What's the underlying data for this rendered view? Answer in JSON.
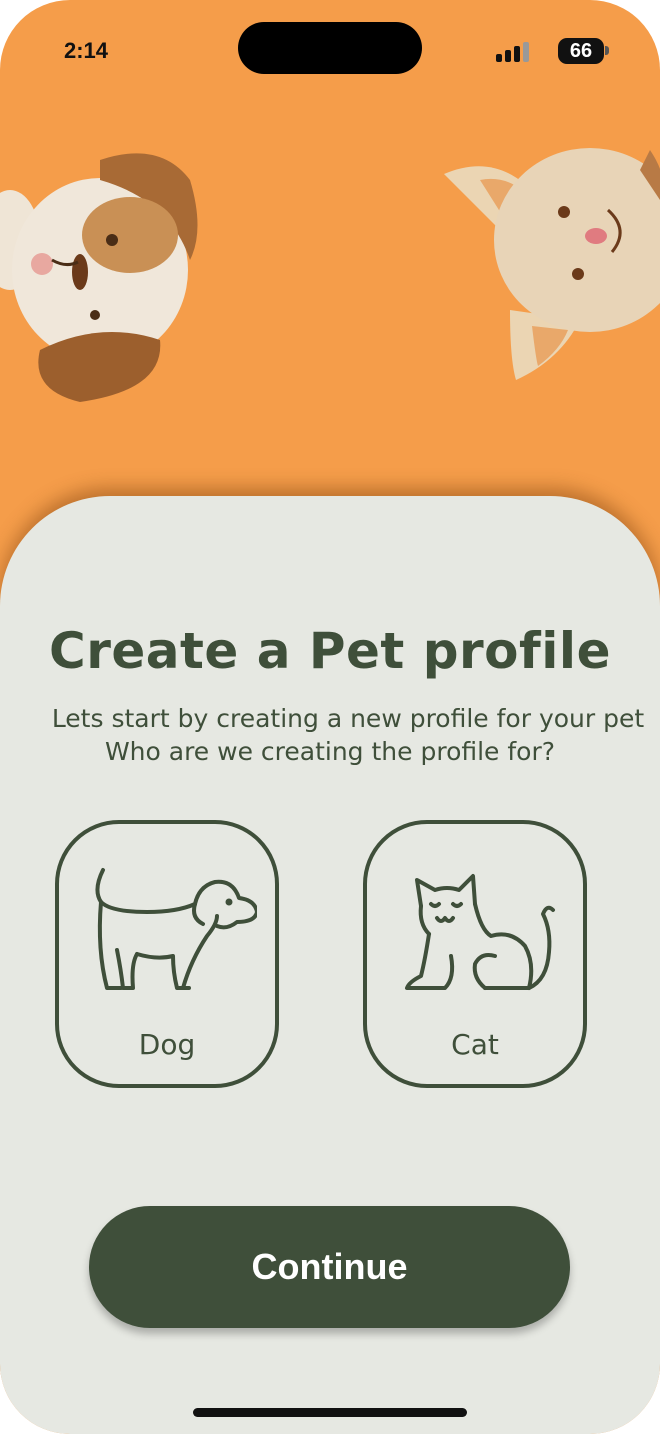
{
  "status_bar": {
    "time": "2:14",
    "battery": "66"
  },
  "illustrations": {
    "dog": "dog-face-icon",
    "cat": "cat-face-icon"
  },
  "sheet": {
    "title": "Create a Pet profile",
    "subtitle_line1": "Lets start by creating a new profile for your pet",
    "subtitle_line2": "Who are we creating the profile for?"
  },
  "choices": [
    {
      "label": "Dog",
      "icon": "dog-outline-icon"
    },
    {
      "label": "Cat",
      "icon": "cat-outline-icon"
    }
  ],
  "continue_label": "Continue",
  "colors": {
    "header_orange": "#f59d4a",
    "sheet_background": "#e6e8e2",
    "primary_green": "#3f4f3a",
    "button_text": "#ffffff"
  }
}
